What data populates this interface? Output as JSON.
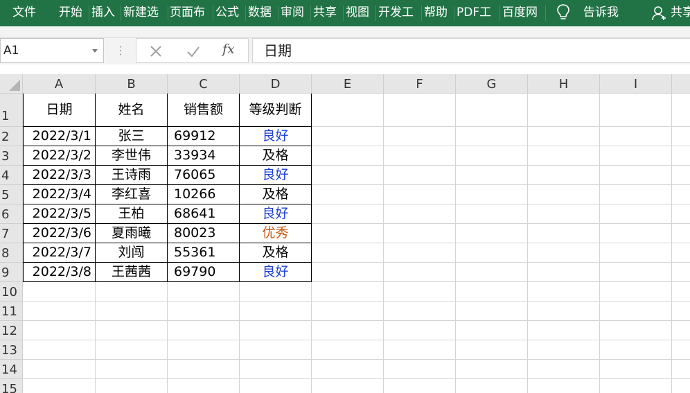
{
  "ribbon": {
    "tabs": [
      "文件",
      "开始",
      "插入",
      "新建选",
      "页面布",
      "公式",
      "数据",
      "审阅",
      "共享",
      "视图",
      "开发工",
      "帮助",
      "PDF工",
      "百度网"
    ],
    "tell_me": "告诉我",
    "share": "共享",
    "icons": [
      "lightbulb-icon",
      "person-icon"
    ]
  },
  "formula_bar": {
    "name_box": "A1",
    "more_dots": "⋮",
    "cancel_icon": "x-icon",
    "confirm_icon": "check-icon",
    "function_label": "fx",
    "content": "日期"
  },
  "columns": [
    "A",
    "B",
    "C",
    "D",
    "E",
    "F",
    "G",
    "H",
    "I"
  ],
  "rows": [
    "1",
    "2",
    "3",
    "4",
    "5",
    "6",
    "7",
    "8",
    "9",
    "10",
    "11",
    "12",
    "13",
    "14",
    "15"
  ],
  "table": {
    "headers": [
      "日期",
      "姓名",
      "销售额",
      "等级判断"
    ],
    "rows": [
      [
        "2022/3/1",
        "张三",
        "69912",
        "良好"
      ],
      [
        "2022/3/2",
        "李世伟",
        "33934",
        "及格"
      ],
      [
        "2022/3/3",
        "王诗雨",
        "76065",
        "良好"
      ],
      [
        "2022/3/4",
        "李红喜",
        "10266",
        "及格"
      ],
      [
        "2022/3/5",
        "王柏",
        "68641",
        "良好"
      ],
      [
        "2022/3/6",
        "夏雨曦",
        "80023",
        "优秀"
      ],
      [
        "2022/3/7",
        "刘闯",
        "55361",
        "及格"
      ],
      [
        "2022/3/8",
        "王茜茜",
        "69790",
        "良好"
      ]
    ],
    "grade_colors": {
      "良好": "#1f3fd0",
      "及格": "#000000",
      "优秀": "#c55a11"
    }
  },
  "colors": {
    "ribbon": "#217346",
    "header_bg": "#e6e6e6",
    "gridline": "#d4d4d4"
  }
}
